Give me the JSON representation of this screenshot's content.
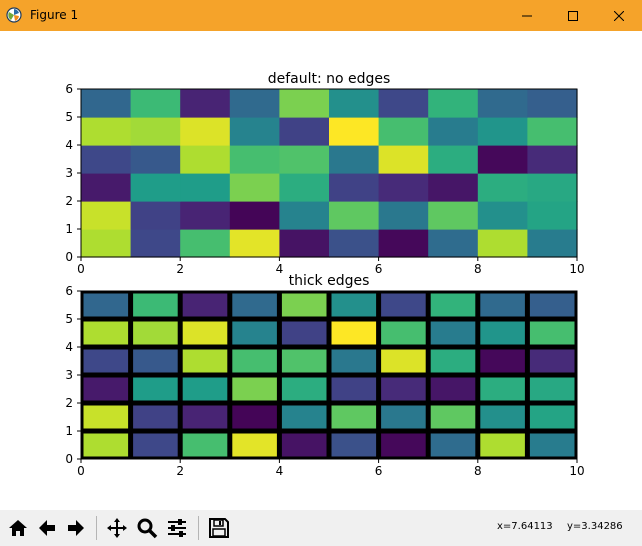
{
  "window": {
    "title": "Figure 1",
    "minimize_glyph": "—",
    "maximize_glyph": "☐",
    "close_glyph": "✕"
  },
  "toolbar": {
    "buttons": [
      "home-icon",
      "back-icon",
      "forward-icon",
      "pan-icon",
      "zoom-icon",
      "configure-subplots-icon",
      "save-icon"
    ],
    "x_readout": "x=7.64113",
    "y_readout": "y=3.34286"
  },
  "colors": {
    "titlebar": "#f5a32a",
    "toolbar": "#f0f0f0",
    "edge": "#000000"
  },
  "chart_data": [
    {
      "type": "heatmap",
      "title": "default: no edges",
      "xlim": [
        0,
        10
      ],
      "ylim": [
        0,
        6
      ],
      "xticks": [
        "0",
        "2",
        "4",
        "6",
        "8",
        "10"
      ],
      "yticks": [
        "0",
        "1",
        "2",
        "3",
        "4",
        "5",
        "6"
      ],
      "colormap": "viridis",
      "edges": false,
      "values": [
        [
          0.88,
          0.22,
          0.7,
          0.96,
          0.05,
          0.25,
          0.02,
          0.35,
          0.88,
          0.42
        ],
        [
          0.92,
          0.2,
          0.1,
          0.01,
          0.45,
          0.75,
          0.4,
          0.75,
          0.5,
          0.58
        ],
        [
          0.07,
          0.55,
          0.55,
          0.8,
          0.62,
          0.2,
          0.12,
          0.06,
          0.62,
          0.6
        ],
        [
          0.22,
          0.28,
          0.88,
          0.7,
          0.72,
          0.4,
          0.95,
          0.62,
          0.02,
          0.12
        ],
        [
          0.88,
          0.86,
          0.95,
          0.45,
          0.2,
          1.0,
          0.7,
          0.42,
          0.52,
          0.7
        ],
        [
          0.33,
          0.68,
          0.1,
          0.34,
          0.8,
          0.5,
          0.22,
          0.65,
          0.34,
          0.3
        ]
      ]
    },
    {
      "type": "heatmap",
      "title": "thick edges",
      "xlim": [
        0,
        10
      ],
      "ylim": [
        0,
        6
      ],
      "xticks": [
        "0",
        "2",
        "4",
        "6",
        "8",
        "10"
      ],
      "yticks": [
        "0",
        "1",
        "2",
        "3",
        "4",
        "5",
        "6"
      ],
      "colormap": "viridis",
      "edges": true,
      "values": [
        [
          0.88,
          0.22,
          0.7,
          0.96,
          0.05,
          0.25,
          0.02,
          0.35,
          0.88,
          0.42
        ],
        [
          0.92,
          0.2,
          0.1,
          0.01,
          0.45,
          0.75,
          0.4,
          0.75,
          0.5,
          0.58
        ],
        [
          0.07,
          0.55,
          0.55,
          0.8,
          0.62,
          0.2,
          0.12,
          0.06,
          0.62,
          0.6
        ],
        [
          0.22,
          0.28,
          0.88,
          0.7,
          0.72,
          0.4,
          0.95,
          0.62,
          0.02,
          0.12
        ],
        [
          0.88,
          0.86,
          0.95,
          0.45,
          0.2,
          1.0,
          0.7,
          0.42,
          0.52,
          0.7
        ],
        [
          0.33,
          0.68,
          0.1,
          0.34,
          0.8,
          0.5,
          0.22,
          0.65,
          0.34,
          0.3
        ]
      ]
    }
  ]
}
